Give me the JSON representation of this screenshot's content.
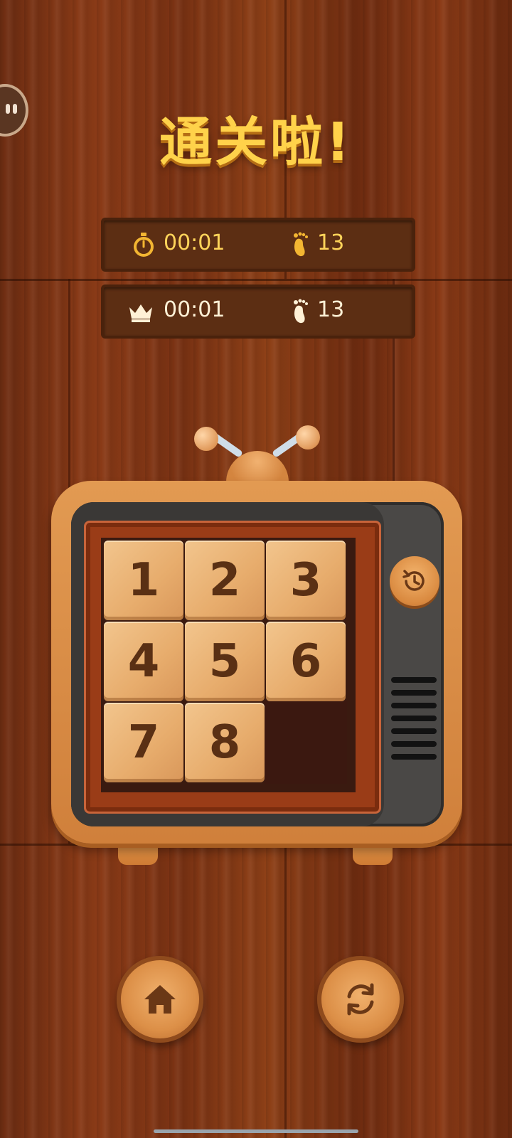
{
  "title": "通关啦!",
  "current_result": {
    "time_icon": "stopwatch-icon",
    "time": "00:01",
    "steps_icon": "footprint-icon",
    "steps": "13"
  },
  "best_result": {
    "time_icon": "crown-icon",
    "time": "00:01",
    "steps_icon": "footprint-icon",
    "steps": "13"
  },
  "board": {
    "size": 3,
    "tiles": [
      "1",
      "2",
      "3",
      "4",
      "5",
      "6",
      "7",
      "8",
      ""
    ]
  },
  "buttons": {
    "undo_icon": "history-icon",
    "home_icon": "home-icon",
    "restart_icon": "refresh-icon"
  },
  "colors": {
    "title": "#ffd24a",
    "stat_value": "#ffd45a",
    "tile": "#e7ac6c",
    "tile_text": "#5a3014"
  }
}
